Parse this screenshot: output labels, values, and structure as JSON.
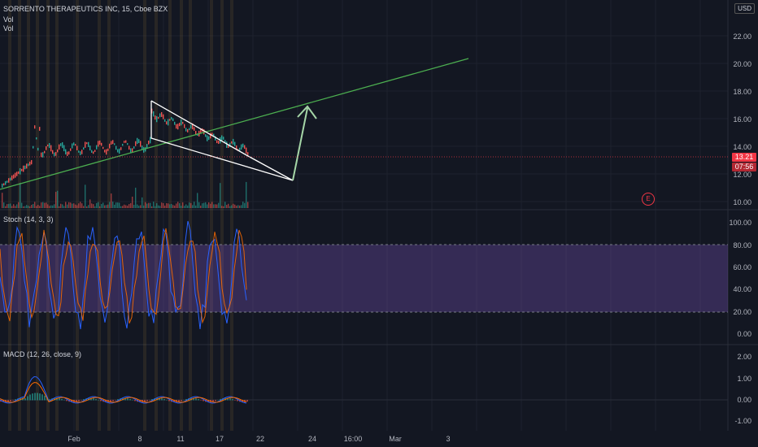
{
  "header": {
    "title": "SORRENTO THERAPEUTICS INC, 15, Cboe BZX",
    "vol1": "Vol",
    "vol2": "Vol"
  },
  "currency_button": "USD",
  "price_axis": [
    "22.00",
    "20.00",
    "18.00",
    "16.00",
    "14.00",
    "12.00",
    "10.00"
  ],
  "last_price": "13.21",
  "countdown": "07:56",
  "earnings_badge": "E",
  "stoch": {
    "label": "Stoch (14, 3, 3)",
    "axis": [
      "100.00",
      "80.00",
      "60.00",
      "40.00",
      "20.00",
      "0.00"
    ],
    "band_color": "#7e57c2"
  },
  "macd": {
    "label": "MACD (12, 26, close, 9)",
    "axis": [
      "2.00",
      "1.00",
      "0.00",
      "-1.00"
    ]
  },
  "time_axis": [
    "Feb",
    "8",
    "11",
    "17",
    "22",
    "24",
    "16:00",
    "Mar",
    "3"
  ],
  "colors": {
    "background": "#131722",
    "up": "#26a69a",
    "down": "#ef5350",
    "trendline": "#4caf50",
    "wedge": "#ffffff",
    "arrow": "#a5d6a7",
    "stoch_k": "#2962ff",
    "stoch_d": "#ff6d00",
    "price_box": "#f23645"
  }
}
